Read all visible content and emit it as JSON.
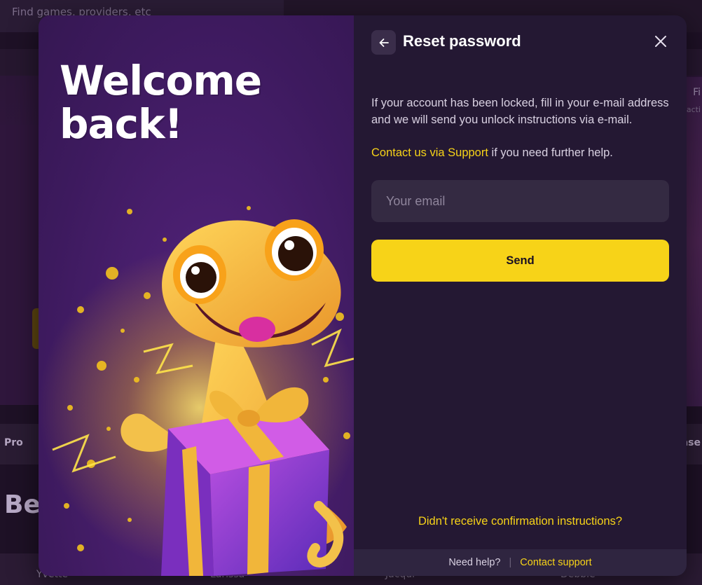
{
  "background": {
    "search_placeholder": "Find games, providers, etc",
    "side_text_right_1": "Fi",
    "side_text_right_2": "acti",
    "promo_row_left": "Pro",
    "promo_row_right": "ase",
    "heading": "Be",
    "thumb_labels": [
      "Yvette",
      "Larissa",
      "Jacqui",
      "Debbie"
    ]
  },
  "promo": {
    "title_line1": "Welcome",
    "title_line2": "back!"
  },
  "dialog": {
    "title": "Reset password",
    "description": "If your account has been locked, fill in your e-mail address and we will send you unlock instructions via e-mail.",
    "support_link": "Contact us via Support",
    "support_suffix": " if you need further help.",
    "email_placeholder": "Your email",
    "send_label": "Send",
    "resend_link": "Didn't receive confirmation instructions?",
    "footer_help": "Need help?",
    "footer_separator": "|",
    "footer_contact": "Contact support"
  },
  "colors": {
    "accent": "#f7d318",
    "panel": "#241833",
    "input_bg": "#342a42"
  },
  "icons": {
    "back": "arrow-left-icon",
    "close": "close-icon"
  }
}
